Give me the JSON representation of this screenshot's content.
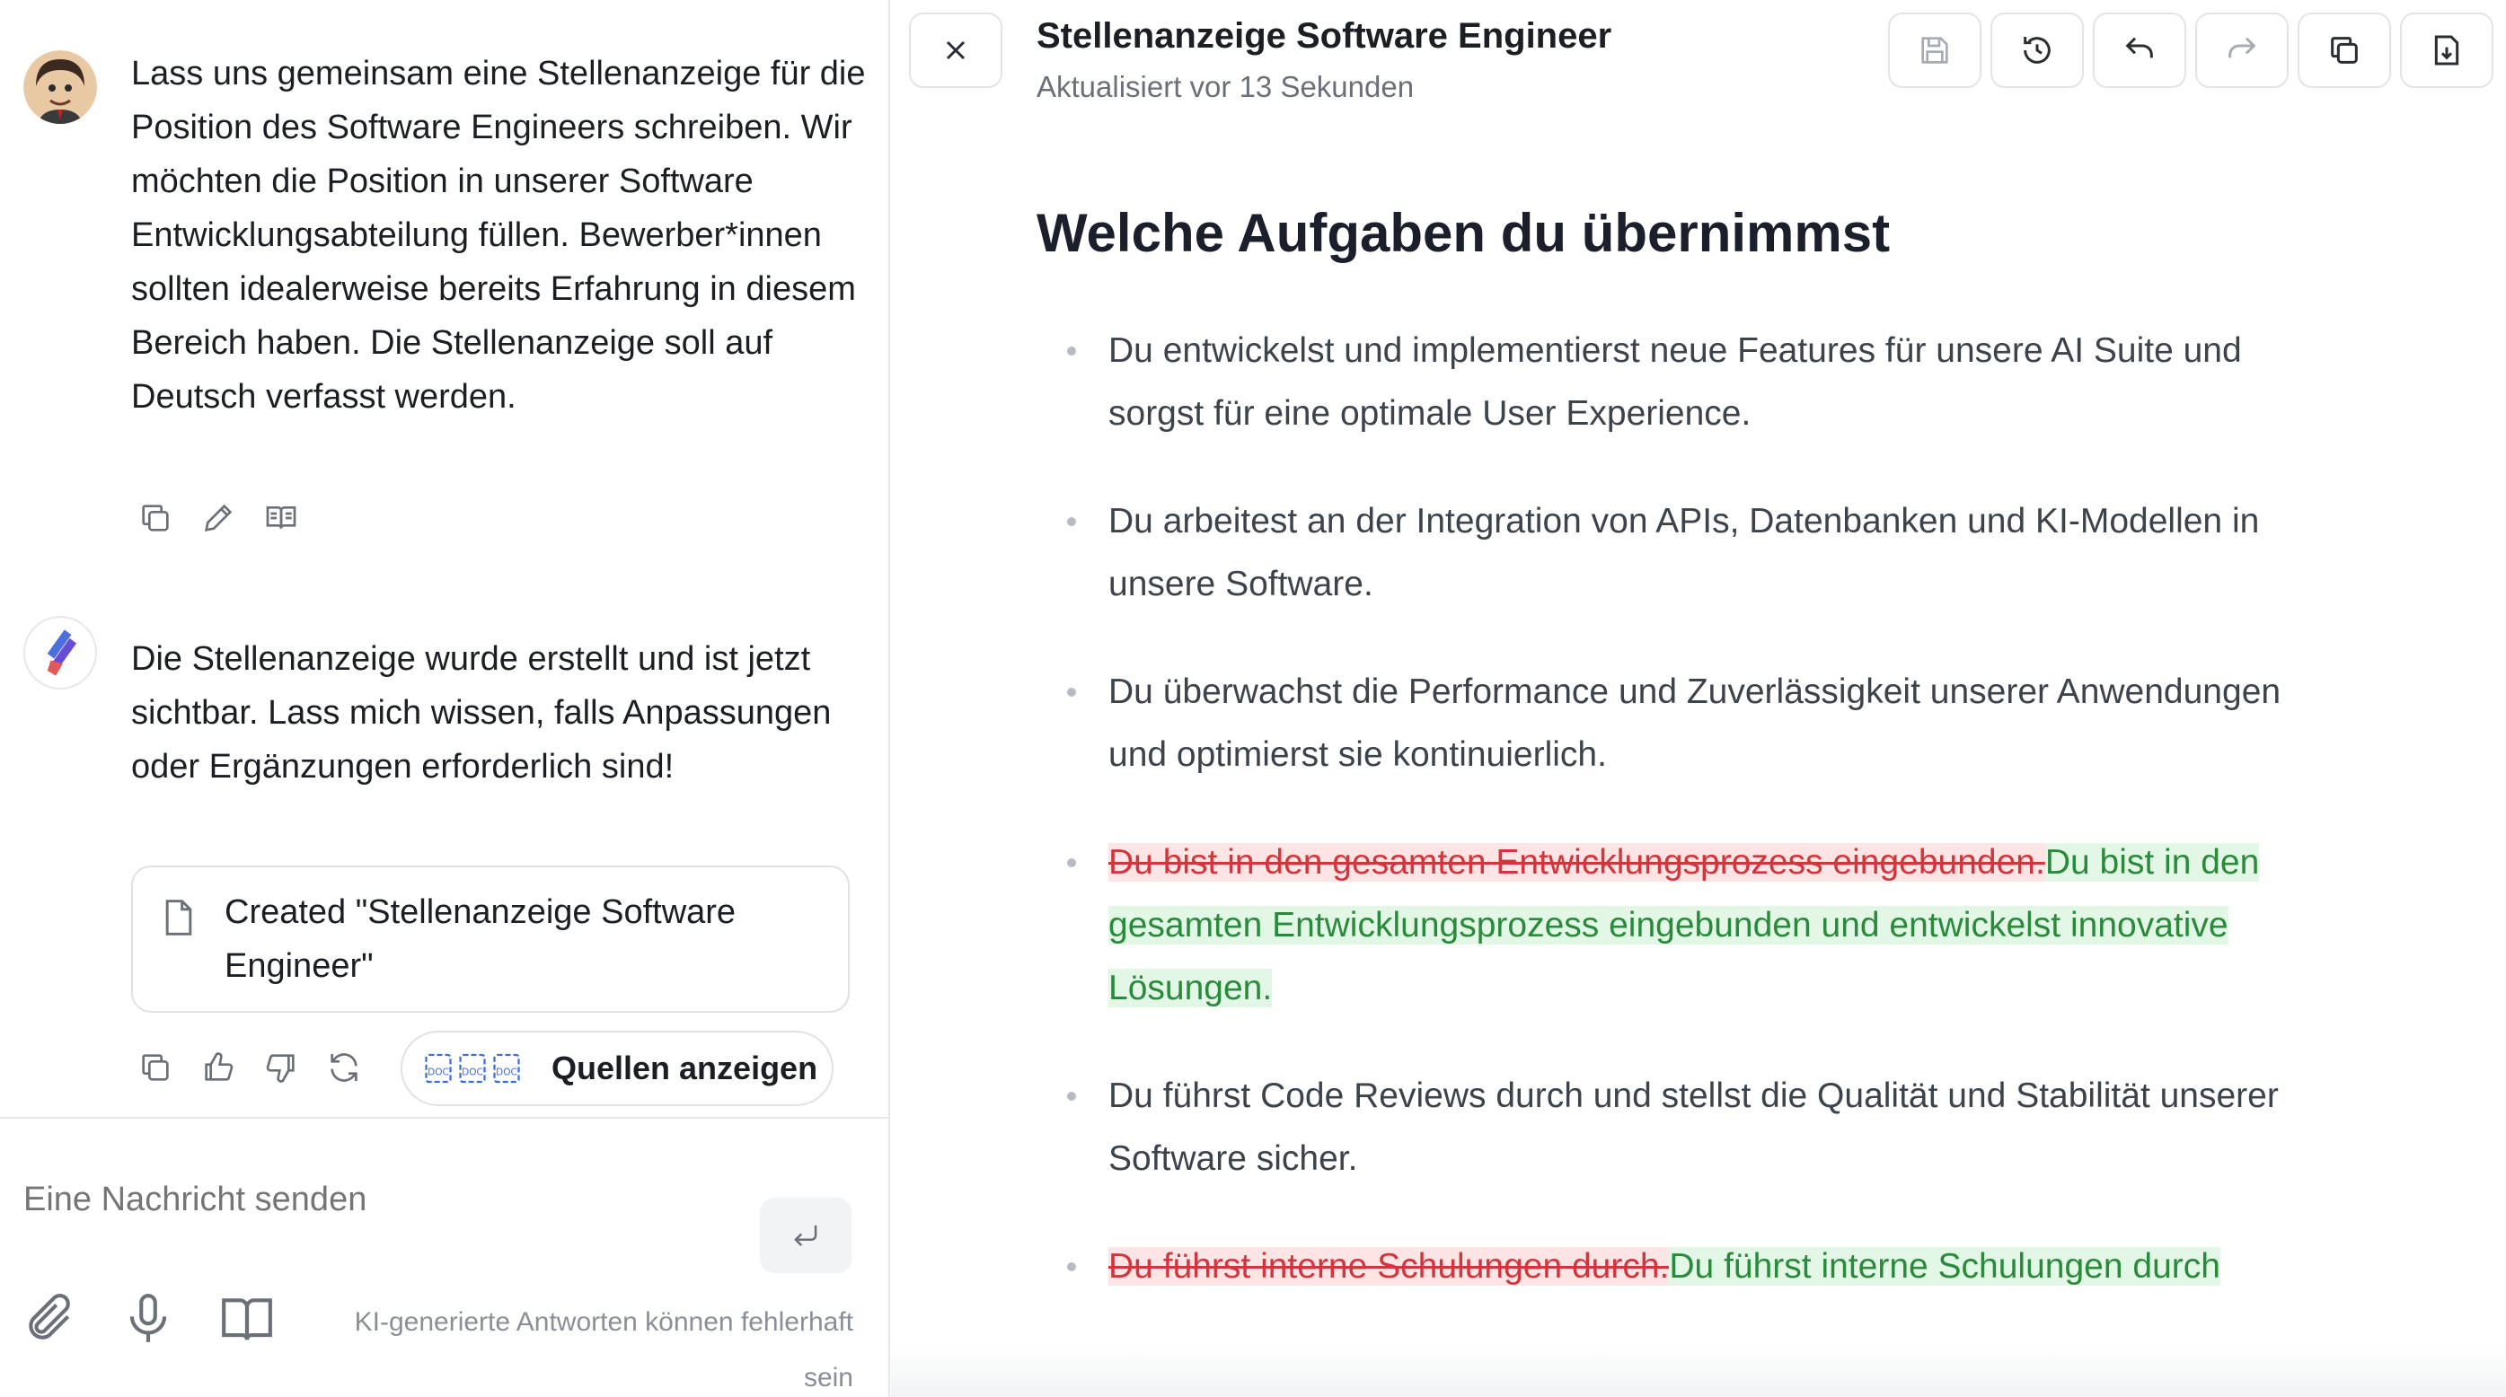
{
  "chat": {
    "user_message": "Lass uns gemeinsam eine Stellenanzeige für die Position des Software Engineers schreiben. Wir möchten die Position in unserer Software Entwicklungsabteilung füllen. Bewerber*innen sollten idealerweise bereits Erfahrung in diesem Bereich haben. Die Stellenanzeige soll auf Deutsch verfasst werden.",
    "assistant_message": "Die Stellenanzeige wurde erstellt und ist jetzt sichtbar. Lass mich wissen, falls Anpassungen oder Ergänzungen erforderlich sind!",
    "file_card": "Created \"Stellenanzeige Software Engineer\"",
    "sources_button": "Quellen anzeigen",
    "sources_doc_labels": [
      "DOC",
      "DOC",
      "DOC"
    ]
  },
  "composer": {
    "placeholder": "Eine Nachricht senden",
    "disclaimer": "KI-generierte Antworten können fehlerhaft sein"
  },
  "document": {
    "title": "Stellenanzeige Software Engineer",
    "subtitle": "Aktualisiert vor 13 Sekunden",
    "heading": "Welche Aufgaben du übernimmst",
    "items": [
      {
        "text": "Du entwickelst und implementierst neue Features für unsere AI Suite und sorgst für eine optimale User Experience."
      },
      {
        "text": "Du arbeitest an der Integration von APIs, Datenbanken und KI-Modellen in unsere Software."
      },
      {
        "text": "Du überwachst die Performance und Zuverlässigkeit unserer Anwendungen und optimierst sie kontinuierlich."
      },
      {
        "deleted": "Du bist in den gesamten Entwicklungsprozess eingebunden.",
        "inserted": "Du bist in den gesamten Entwicklungsprozess eingebunden und entwickelst innovative Lösungen."
      },
      {
        "text": "Du führst Code Reviews durch und stellst die Qualität und Stabilität unserer Software sicher."
      },
      {
        "deleted": "Du führst interne Schulungen durch.",
        "inserted": "Du führst interne Schulungen durch"
      }
    ]
  },
  "colors": {
    "deleted_text": "#d0373d",
    "deleted_bg": "#fde5e6",
    "inserted_text": "#2a8a3b",
    "inserted_bg": "#e3f7e6"
  }
}
